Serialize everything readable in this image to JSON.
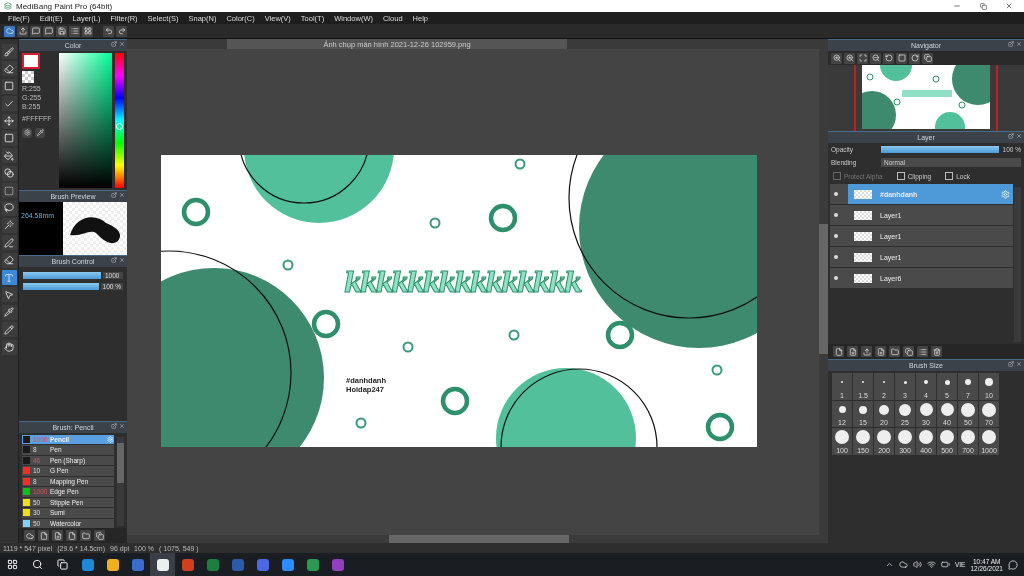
{
  "window": {
    "title": "MediBang Paint Pro (64bit)"
  },
  "menu": [
    "File(F)",
    "Edit(E)",
    "Layer(L)",
    "Filter(R)",
    "Select(S)",
    "Snap(N)",
    "Color(C)",
    "View(V)",
    "Tool(T)",
    "Window(W)",
    "Cloud",
    "Help"
  ],
  "tools": [
    {
      "kind": "brush",
      "selected": false
    },
    {
      "kind": "eraser",
      "selected": false
    },
    {
      "kind": "rect",
      "selected": false
    },
    {
      "kind": "check",
      "selected": false
    },
    {
      "kind": "move",
      "selected": false
    },
    {
      "kind": "fill",
      "selected": false
    },
    {
      "kind": "bucket",
      "selected": false
    },
    {
      "kind": "gradient",
      "selected": false
    },
    {
      "kind": "select",
      "selected": false
    },
    {
      "kind": "lasso",
      "selected": false
    },
    {
      "kind": "wand",
      "selected": false
    },
    {
      "kind": "selectpen",
      "selected": false
    },
    {
      "kind": "selecteraser",
      "selected": false
    },
    {
      "kind": "text",
      "selected": true
    },
    {
      "kind": "operation",
      "selected": false
    },
    {
      "kind": "dropper",
      "selected": false
    },
    {
      "kind": "pen",
      "selected": false
    },
    {
      "kind": "hand",
      "selected": false
    }
  ],
  "color_panel": {
    "title": "Color",
    "rgb": [
      "R:255",
      "G:255",
      "B:255"
    ],
    "hex": "#FFFFFF"
  },
  "brush_preview": {
    "title": "Brush Preview",
    "size": "264.58mm"
  },
  "brush_control": {
    "title": "Brush Control",
    "sliders": [
      {
        "level": 1,
        "reading": "1000"
      },
      {
        "level": 1,
        "reading": "100 %"
      }
    ]
  },
  "brush_list": {
    "title": "Brush: Pencil",
    "items": [
      {
        "color": "#1a1a1a",
        "size": "1000",
        "size_flag": true,
        "name": "Pencil",
        "selected": true
      },
      {
        "color": "#1a1a1a",
        "size": "8",
        "size_flag": false,
        "name": "Pen",
        "selected": false
      },
      {
        "color": "#1a1a1a",
        "size": "46",
        "size_flag": true,
        "name": "Pen (Sharp)",
        "selected": false
      },
      {
        "color": "#ff2a2a",
        "size": "10",
        "size_flag": false,
        "name": "G Pen",
        "selected": false
      },
      {
        "color": "#ff2a2a",
        "size": "8",
        "size_flag": false,
        "name": "Mapping Pen",
        "selected": false
      },
      {
        "color": "#10c010",
        "size": "1000",
        "size_flag": true,
        "name": "Edge Pen",
        "selected": false
      },
      {
        "color": "#f0e010",
        "size": "50",
        "size_flag": false,
        "name": "Stipple Pen",
        "selected": false
      },
      {
        "color": "#f0e010",
        "size": "30",
        "size_flag": false,
        "name": "Sumi",
        "selected": false
      },
      {
        "color": "#7fd4ff",
        "size": "50",
        "size_flag": false,
        "name": "Watercolor",
        "selected": false
      }
    ]
  },
  "document": {
    "tab_title": "Ảnh chụp màn hình 2021-12-26 102959.png",
    "artwork_title": "kkkkkkkkkkkkkkk",
    "tag_lines": [
      "#danhdanh",
      "Hoidap247"
    ]
  },
  "navigator": {
    "title": "Navigator"
  },
  "layer_panel": {
    "title": "Layer",
    "opacity_label": "Opacity",
    "opacity": {
      "level": 1,
      "reading": "100 %"
    },
    "blending_label": "Blending",
    "blending": "Normal",
    "options": [
      {
        "label": "Protect Alpha",
        "checked": false,
        "disabled": true
      },
      {
        "label": "Clipping",
        "checked": false,
        "disabled": false
      },
      {
        "label": "Lock",
        "checked": false,
        "disabled": false
      }
    ],
    "layers": [
      {
        "name": "#danhdanh",
        "selected": true,
        "visible": true
      },
      {
        "name": "Layer1",
        "selected": false,
        "visible": true
      },
      {
        "name": "Layer1",
        "selected": false,
        "visible": true
      },
      {
        "name": "Layer1",
        "selected": false,
        "visible": true
      },
      {
        "name": "Layer6",
        "selected": false,
        "visible": true
      }
    ]
  },
  "brush_size": {
    "title": "Brush Size",
    "sizes": [
      "1",
      "1.5",
      "2",
      "3",
      "4",
      "5",
      "7",
      "10",
      "12",
      "15",
      "20",
      "25",
      "30",
      "40",
      "50",
      "70",
      "100",
      "150",
      "200",
      "300",
      "400",
      "500",
      "700",
      "1000"
    ]
  },
  "status_bar": [
    "1119 * 547 pixel",
    "(29.6 * 14.5cm)",
    "96 dpi",
    "100 %",
    "( 1075, 549 )"
  ],
  "taskbar": {
    "language": "VIE",
    "time": "10:47 AM",
    "date": "12/26/2021"
  }
}
